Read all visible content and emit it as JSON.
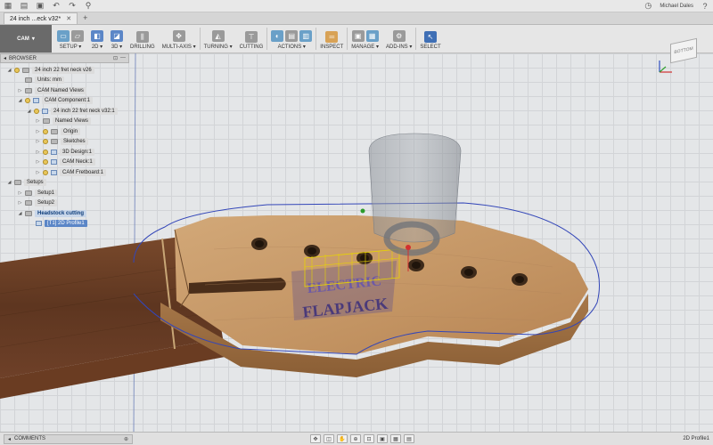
{
  "user_name": "Michael Dales",
  "tab": {
    "title": "24 inch ...eck v32*"
  },
  "ribbon": {
    "workspace": "CAM",
    "groups": [
      {
        "label": "SETUP ▾",
        "icons": [
          "setup-icon",
          "folder-icon"
        ]
      },
      {
        "label": "2D ▾",
        "icons": [
          "2d-icon"
        ]
      },
      {
        "label": "3D ▾",
        "icons": [
          "3d-icon"
        ]
      },
      {
        "label": "DRILLING",
        "icons": [
          "drill-icon"
        ]
      },
      {
        "label": "MULTI-AXIS ▾",
        "icons": [
          "multiaxis-icon"
        ]
      },
      {
        "label": "TURNING ▾",
        "icons": [
          "turning-icon"
        ]
      },
      {
        "label": "CUTTING",
        "icons": [
          "cutting-icon"
        ]
      },
      {
        "label": "ACTIONS ▾",
        "icons": [
          "action1-icon",
          "action2-icon",
          "action3-icon"
        ]
      },
      {
        "label": "INSPECT",
        "icons": [
          "inspect-icon"
        ]
      },
      {
        "label": "MANAGE ▾",
        "icons": [
          "manage1-icon",
          "manage2-icon"
        ]
      },
      {
        "label": "ADD-INS ▾",
        "icons": [
          "addins-icon"
        ]
      },
      {
        "label": "SELECT",
        "icons": [
          "select-icon"
        ]
      }
    ]
  },
  "browser": {
    "title": "BROWSER",
    "nodes": [
      {
        "label": "24 inch 22 fret neck v26",
        "depth": 0
      },
      {
        "label": "Units: mm",
        "depth": 1
      },
      {
        "label": "CAM Named Views",
        "depth": 1
      },
      {
        "label": "CAM Component:1",
        "depth": 1
      },
      {
        "label": "24 inch 22 fret neck v32:1",
        "depth": 2
      },
      {
        "label": "Named Views",
        "depth": 3
      },
      {
        "label": "Origin",
        "depth": 3
      },
      {
        "label": "Sketches",
        "depth": 3
      },
      {
        "label": "3D Design:1",
        "depth": 3
      },
      {
        "label": "CAM Neck:1",
        "depth": 3
      },
      {
        "label": "CAM Fretboard:1",
        "depth": 3
      },
      {
        "label": "Setups",
        "depth": 0
      },
      {
        "label": "Setup1",
        "depth": 1
      },
      {
        "label": "Setup2",
        "depth": 1
      },
      {
        "label": "Headstock cutting",
        "depth": 1
      },
      {
        "label": "[T1] 2D Profile1",
        "depth": 2
      }
    ]
  },
  "viewcube": {
    "label": "BOTTOM"
  },
  "headstock": {
    "logo_line1": "ELECTRIC",
    "logo_line2": "FLAPJACK"
  },
  "comments": {
    "label": "COMMENTS"
  },
  "status": {
    "text": "2D Profile1"
  }
}
